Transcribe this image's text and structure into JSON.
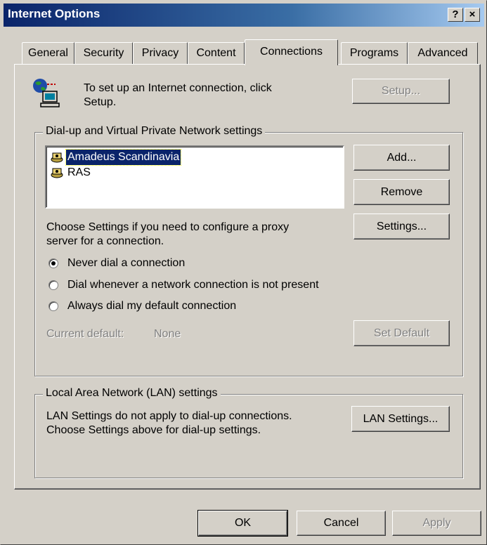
{
  "window": {
    "title": "Internet Options",
    "help_btn": "?",
    "close_btn": "×"
  },
  "tabs": [
    {
      "label": "General"
    },
    {
      "label": "Security"
    },
    {
      "label": "Privacy"
    },
    {
      "label": "Content"
    },
    {
      "label": "Connections"
    },
    {
      "label": "Programs"
    },
    {
      "label": "Advanced"
    }
  ],
  "setup": {
    "line1": "To set up an Internet connection, click",
    "line2": "Setup.",
    "button": "Setup..."
  },
  "dialup": {
    "group_label": "Dial-up and Virtual Private Network settings",
    "connections": [
      {
        "name": "Amadeus Scandinavia",
        "selected": true
      },
      {
        "name": "RAS",
        "selected": false
      }
    ],
    "add": "Add...",
    "remove": "Remove",
    "settings": "Settings...",
    "proxy_line1": "Choose Settings if you need to configure a proxy",
    "proxy_line2": "server for a connection.",
    "options": [
      {
        "label": "Never dial a connection",
        "checked": true
      },
      {
        "label": "Dial whenever a network connection is not present",
        "checked": false
      },
      {
        "label": "Always dial my default connection",
        "checked": false
      }
    ],
    "current_default_label": "Current default:",
    "current_default_value": "None",
    "set_default": "Set Default"
  },
  "lan": {
    "group_label": "Local Area Network (LAN) settings",
    "line1": "LAN Settings do not apply to dial-up connections.",
    "line2": "Choose Settings above for dial-up settings.",
    "button": "LAN Settings..."
  },
  "footer": {
    "ok": "OK",
    "cancel": "Cancel",
    "apply": "Apply"
  },
  "colors": {
    "face": "#d4d0c8",
    "title_start": "#0a246a",
    "title_end": "#a6caf0",
    "selection": "#0a246a"
  }
}
